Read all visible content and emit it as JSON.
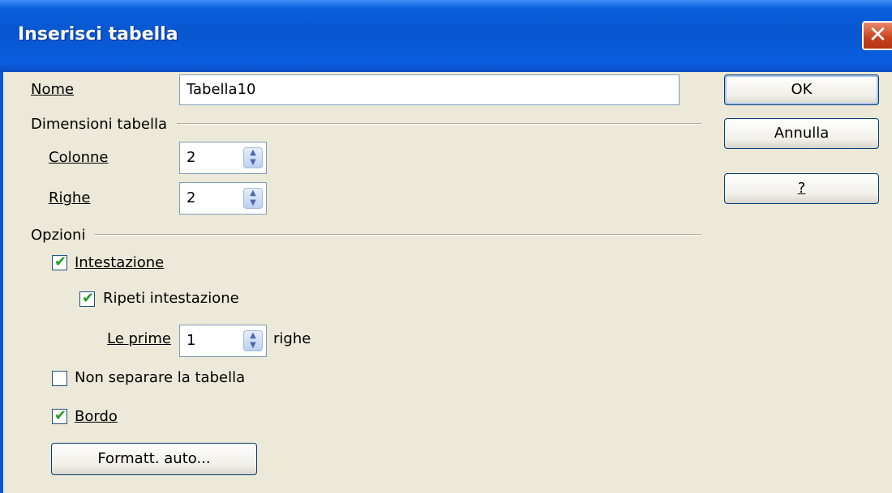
{
  "window": {
    "title": "Inserisci tabella",
    "close_glyph": "✕"
  },
  "name_field": {
    "label": "Nome",
    "value": "Tabella10"
  },
  "dimensions": {
    "heading": "Dimensioni tabella",
    "columns": {
      "label": "Colonne",
      "value": "2"
    },
    "rows": {
      "label": "Righe",
      "value": "2"
    }
  },
  "options": {
    "heading": "Opzioni",
    "header": {
      "label": "Intestazione",
      "checked": true
    },
    "repeat_header": {
      "label": "Ripeti intestazione",
      "checked": true
    },
    "first_rows": {
      "label": "Le prime",
      "value": "1",
      "suffix": "righe"
    },
    "no_split": {
      "label": "Non separare la tabella",
      "checked": false
    },
    "border": {
      "label": "Bordo",
      "checked": true
    },
    "autoformat_button": "Formatt. auto..."
  },
  "buttons": {
    "ok": "OK",
    "cancel": "Annulla",
    "help": "?"
  },
  "spin_glyph_up": "▲",
  "spin_glyph_down": "▼",
  "check_glyph": "✔"
}
